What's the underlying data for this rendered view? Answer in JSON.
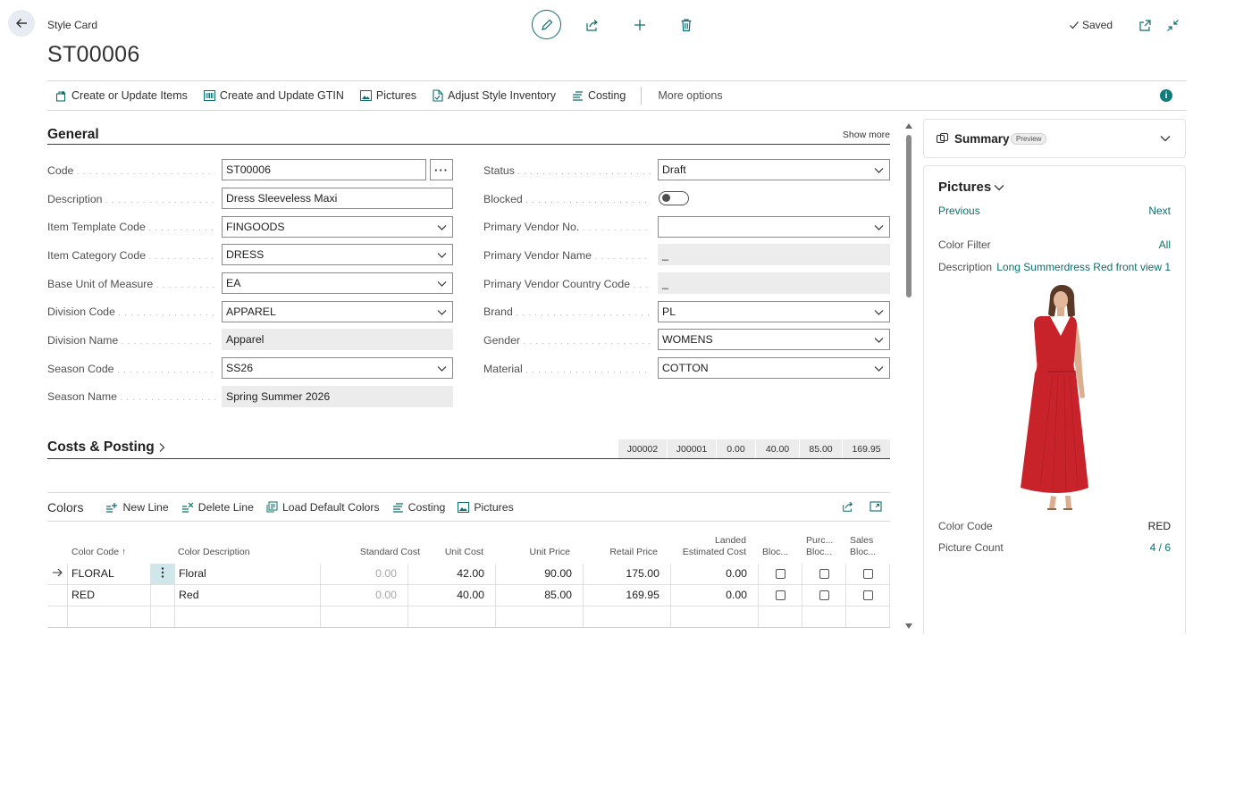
{
  "header": {
    "page_type": "Style Card",
    "title": "ST00006",
    "saved_label": "Saved"
  },
  "actions": {
    "items": [
      {
        "label": "Create or Update Items",
        "icon": "create-items-icon"
      },
      {
        "label": "Create and Update GTIN",
        "icon": "barcode-icon"
      },
      {
        "label": "Pictures",
        "icon": "picture-icon"
      },
      {
        "label": "Adjust Style Inventory",
        "icon": "adjust-document-icon"
      },
      {
        "label": "Costing",
        "icon": "costing-icon"
      }
    ],
    "more_options": "More options"
  },
  "general": {
    "title": "General",
    "show_more": "Show more",
    "left_fields": [
      {
        "label": "Code",
        "value": "ST00006"
      },
      {
        "label": "Description",
        "value": "Dress Sleeveless Maxi"
      },
      {
        "label": "Item Template Code",
        "value": "FINGOODS"
      },
      {
        "label": "Item Category Code",
        "value": "DRESS"
      },
      {
        "label": "Base Unit of Measure",
        "value": "EA"
      },
      {
        "label": "Division Code",
        "value": "APPAREL"
      },
      {
        "label": "Division Name",
        "value": "Apparel"
      },
      {
        "label": "Season Code",
        "value": "SS26"
      },
      {
        "label": "Season Name",
        "value": "Spring Summer 2026"
      }
    ],
    "right_fields": [
      {
        "label": "Status",
        "value": "Draft"
      },
      {
        "label": "Blocked",
        "value": ""
      },
      {
        "label": "Primary Vendor No.",
        "value": ""
      },
      {
        "label": "Primary Vendor Name",
        "value": "_"
      },
      {
        "label": "Primary Vendor Country Code",
        "value": "_"
      },
      {
        "label": "Brand",
        "value": "PL"
      },
      {
        "label": "Gender",
        "value": "WOMENS"
      },
      {
        "label": "Material",
        "value": "COTTON"
      }
    ],
    "blocked": false
  },
  "costs_posting": {
    "title": "Costs & Posting",
    "summary_values": [
      "J00002",
      "J00001",
      "0.00",
      "40.00",
      "85.00",
      "169.95"
    ]
  },
  "colors": {
    "title": "Colors",
    "actions": [
      {
        "label": "New Line",
        "icon": "new-line-icon"
      },
      {
        "label": "Delete Line",
        "icon": "delete-line-icon"
      },
      {
        "label": "Load Default Colors",
        "icon": "load-colors-icon"
      },
      {
        "label": "Costing",
        "icon": "costing-icon"
      },
      {
        "label": "Pictures",
        "icon": "picture-icon"
      }
    ],
    "columns": {
      "color_code": "Color Code",
      "sort_indicator": "↑",
      "color_description": "Color Description",
      "standard_cost": "Standard Cost",
      "unit_cost": "Unit Cost",
      "unit_price": "Unit Price",
      "retail_price": "Retail Price",
      "landed_line1": "Landed",
      "landed_line2": "Estimated Cost",
      "blocked": "Bloc...",
      "purch_line1": "Purc...",
      "purch_line2": "Bloc...",
      "sales_line1": "Sales",
      "sales_line2": "Bloc..."
    },
    "rows": [
      {
        "code": "FLORAL",
        "description": "Floral",
        "standard_cost": "0.00",
        "unit_cost": "42.00",
        "unit_price": "90.00",
        "retail_price": "175.00",
        "landed_cost": "0.00",
        "blocked": false,
        "purch_blocked": false,
        "sales_blocked": false
      },
      {
        "code": "RED",
        "description": "Red",
        "standard_cost": "0.00",
        "unit_cost": "40.00",
        "unit_price": "85.00",
        "retail_price": "169.95",
        "landed_cost": "0.00",
        "blocked": false,
        "purch_blocked": false,
        "sales_blocked": false
      }
    ]
  },
  "factbox": {
    "summary_title": "Summary",
    "preview_badge": "Preview",
    "pictures_title": "Pictures",
    "previous": "Previous",
    "next": "Next",
    "color_filter_label": "Color Filter",
    "color_filter_value": "All",
    "description_label": "Description",
    "description_value": "Long Summerdress Red front view 1",
    "color_code_label": "Color Code",
    "color_code_value": "RED",
    "picture_count_label": "Picture Count",
    "picture_count_value": "4 / 6",
    "dress_color": "#c8232a"
  },
  "colors_theme": {
    "accent": "#0f6d6d",
    "section_underline": "#3a3a6a"
  }
}
